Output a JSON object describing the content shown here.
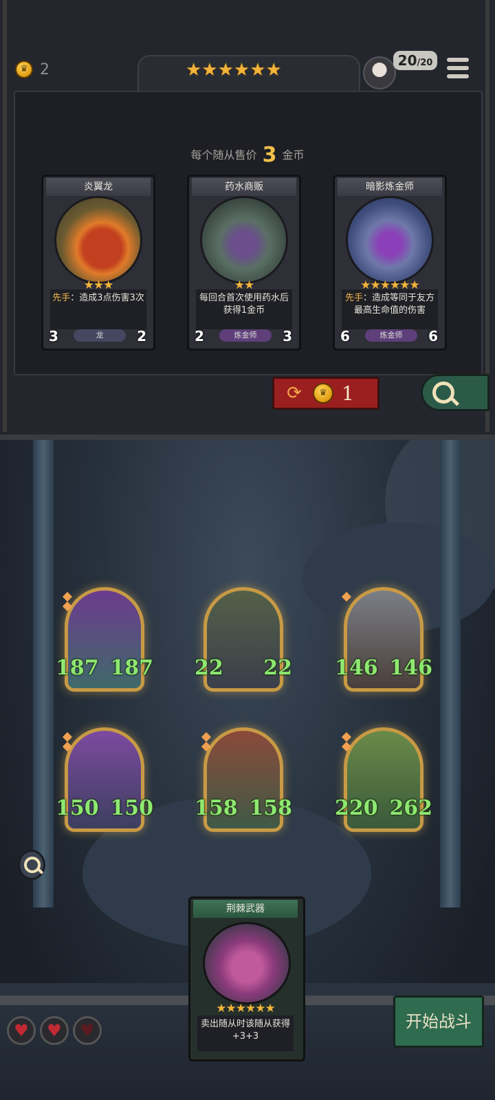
{
  "header": {
    "gold": "2",
    "tier_stars": "★★★★★★",
    "health_current": "20",
    "health_sep": "/",
    "health_max": "20",
    "icons": [
      "coin-icon",
      "menu-icon",
      "avatar"
    ]
  },
  "shop": {
    "price_prefix": "每个随从售价",
    "price_value": "3",
    "price_suffix": "金币",
    "cards": [
      {
        "name": "炎翼龙",
        "stars": "★★★",
        "desc_kw": "先手",
        "desc": "：造成3点伤害3次",
        "attack": "3",
        "health": "2",
        "tribe": "龙"
      },
      {
        "name": "药水商贩",
        "stars": "★★",
        "desc_kw": "",
        "desc": "每回合首次使用药水后获得1金币",
        "attack": "2",
        "health": "3",
        "tribe": "炼金师"
      },
      {
        "name": "暗影炼金师",
        "stars": "★★★★★★",
        "desc_kw": "先手",
        "desc": "：造成等同于友方最高生命值的伤害",
        "attack": "6",
        "health": "6",
        "tribe": "炼金师"
      }
    ],
    "refresh_cost": "1"
  },
  "board": {
    "minions": [
      {
        "attack": "187",
        "health": "187"
      },
      {
        "attack": "22",
        "health": "22"
      },
      {
        "attack": "146",
        "health": "146"
      },
      {
        "attack": "150",
        "health": "150"
      },
      {
        "attack": "158",
        "health": "158"
      },
      {
        "attack": "220",
        "health": "262"
      }
    ],
    "hand_card": {
      "name": "荆棘武器",
      "stars": "★★★★★★",
      "desc": "卖出随从时该随从获得+3+3"
    },
    "lives": {
      "total": 3,
      "remaining": 2
    },
    "start_button": "开始战斗"
  },
  "colors": {
    "gold": "#f3b43a",
    "refresh": "#9b1f1f",
    "start": "#2f6b4f",
    "stat_green": "#8ee870"
  }
}
